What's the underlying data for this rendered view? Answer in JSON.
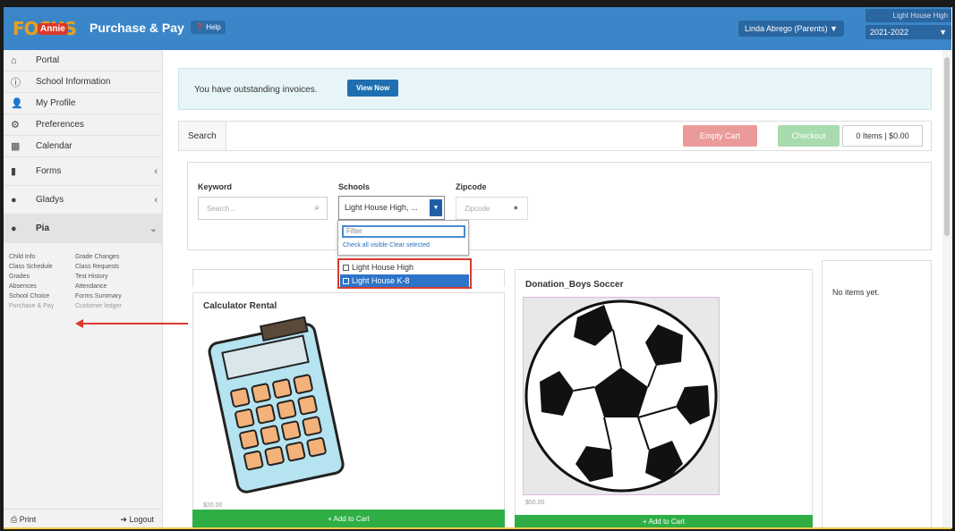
{
  "header": {
    "logo_text": "FOCUS",
    "logo_badge": "Annie",
    "app_title": "Purchase & Pay",
    "help_label": "Help",
    "user_label": "Linda Abrego (Parents) ▼",
    "school_name": "Light House High",
    "school_year": "2021-2022"
  },
  "sidebar": {
    "items": [
      {
        "label": "Portal",
        "icon": "home-icon"
      },
      {
        "label": "School Information",
        "icon": "info-icon"
      },
      {
        "label": "My Profile",
        "icon": "user-icon"
      },
      {
        "label": "Preferences",
        "icon": "gear-icon"
      },
      {
        "label": "Calendar",
        "icon": "calendar-icon"
      },
      {
        "label": "Forms",
        "icon": "document-icon"
      },
      {
        "label": "Gladys",
        "icon": "avatar-icon"
      },
      {
        "label": "Pia",
        "icon": "avatar-icon"
      }
    ],
    "sub_links": [
      [
        "Child Info",
        "Grade Changes"
      ],
      [
        "Class Schedule",
        "Class Requests"
      ],
      [
        "Grades",
        "Test History"
      ],
      [
        "Absences",
        "Attendance"
      ],
      [
        "School Choice",
        "Forms Summary"
      ],
      [
        "Purchase & Pay",
        "Customer ledger"
      ]
    ],
    "print_label": "Print",
    "logout_label": "Logout"
  },
  "notice": {
    "text": "You have outstanding invoices.",
    "button": "View Now"
  },
  "search_bar": {
    "tab_label": "Search",
    "empty_cart": "Empty Cart",
    "checkout": "Checkout",
    "cart_summary": "0 Items | $0.00"
  },
  "filters": {
    "keyword_label": "Keyword",
    "keyword_placeholder": "Search...",
    "schools_label": "Schools",
    "schools_value": "Light House High, ...",
    "zipcode_label": "Zipcode",
    "zipcode_placeholder": "Zipcode",
    "dropdown_filter_placeholder": "Filter",
    "check_all": "Check all visible",
    "clear_selected": "Clear selected",
    "options": [
      "Light House High",
      "Light House K-8"
    ]
  },
  "products": [
    {
      "title": "Calculator Rental",
      "price": "$20.00",
      "button": "+ Add to Cart"
    },
    {
      "title": "Donation_Boys Soccer",
      "price": "$50.00",
      "button": "+ Add to Cart"
    }
  ],
  "cart": {
    "empty_text": "No items yet."
  },
  "colors": {
    "topbar": "#3b86c8",
    "empty_cart": "#eb9a9a",
    "checkout": "#a8dcae",
    "add_to_cart": "#2eae45",
    "annotation": "#d93a2b"
  }
}
